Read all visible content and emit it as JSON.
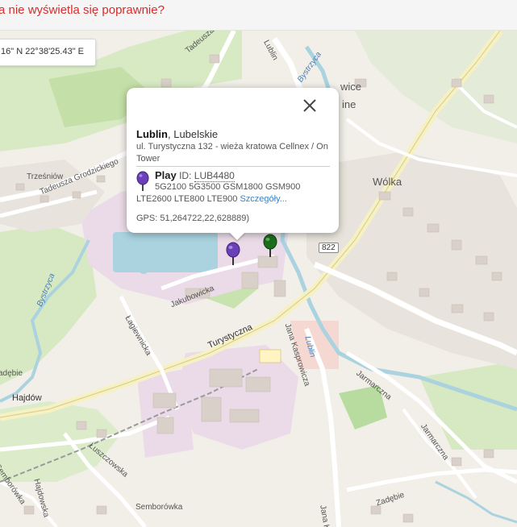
{
  "banner": {
    "text": "a nie wyświetla się poprawnie?"
  },
  "coords": {
    "text": "16\" N 22°38'25.43\" E"
  },
  "popup": {
    "city": "Lublin",
    "region": ", Lubelskie",
    "address": "ul. Turystyczna 132 - wieża kratowa Cellnex / On Tower",
    "operator": "Play",
    "id_label": "ID: ",
    "id_value": "LUB4480",
    "bands_line1": "5G2100 5G3500 GSM1800 GSM900",
    "bands_line2": "LTE2600 LTE800 LTE900",
    "details_link": "Szczegóły...",
    "gps": "GPS: 51,264722,22,628889)"
  },
  "map_labels": {
    "trzesniow": "Trześniów",
    "grodzickiego": "Tadeusza Grodzickiego",
    "bystrzyca1": "Bystrzyca",
    "bystrzyca2": "Bystrzyca",
    "bystrzyca3": "Bystrzyca",
    "wolka": "Wólka",
    "jakubowicka": "Jakubowicka",
    "lagiewnicka": "Łagiewnicka",
    "turystyczna": "Turystyczna",
    "kasprowicza": "Jana Kasprowicza",
    "kasprowicza2": "Jana Ka",
    "hajdow": "Hajdów",
    "jarmarczna": "Jarmarczna",
    "jarmarczna2": "Jarmarczna",
    "luszczowska": "Łuszczowska",
    "semborowka": "Semborówka",
    "semborowka2": "Semborówka",
    "hajdowska": "Hajdowska",
    "zadebie": "Zadębie",
    "zadebie_left": "adębie",
    "lublin_small": "Lublin",
    "lublin_mid": "Lublin",
    "tadeusza_top": "Tadeusza",
    "wice": "wice",
    "ine": "ine",
    "road_822": "822"
  },
  "colors": {
    "operator_pin": "#6a3fb8",
    "other_pin": "#1b6e1b",
    "banner_text": "#d32f2f"
  }
}
